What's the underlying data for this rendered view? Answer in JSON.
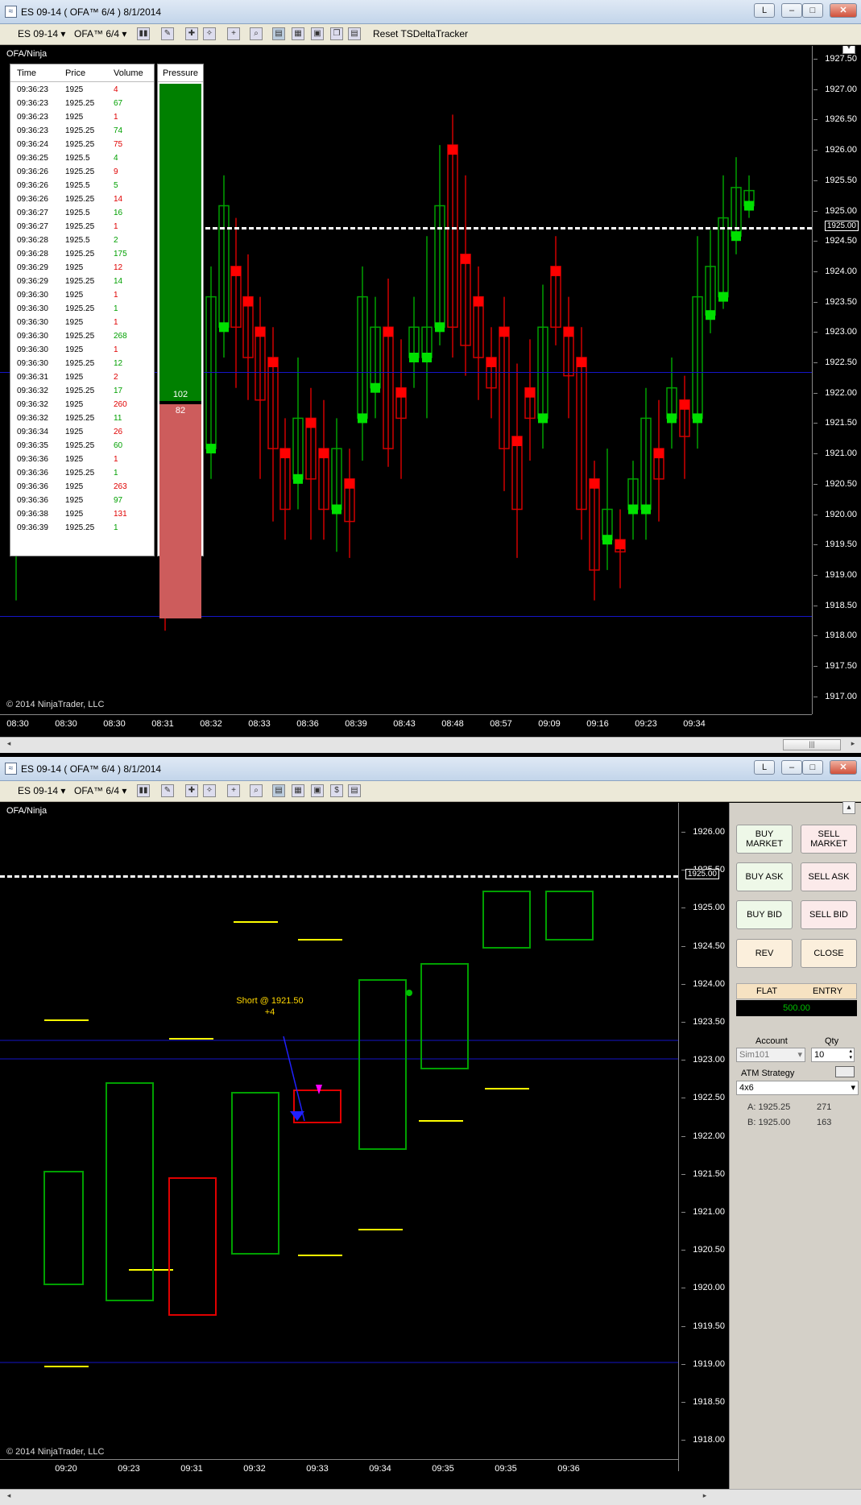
{
  "window_top": {
    "title": "ES 09-14 ( OFA™ 6/4 )  8/1/2014",
    "toolbar": {
      "instrument": "ES 09-14",
      "period": "OFA™ 6/4",
      "reset_label": "Reset TSDeltaTracker"
    },
    "chart_label": "OFA/Ninja",
    "copyright": "© 2014 NinjaTrader, LLC",
    "last_price": "1925.00",
    "y_ticks": [
      "1927.50",
      "1927.00",
      "1926.50",
      "1926.00",
      "1925.50",
      "1925.00",
      "1924.50",
      "1924.00",
      "1923.50",
      "1923.00",
      "1922.50",
      "1922.00",
      "1921.50",
      "1921.00",
      "1920.50",
      "1920.00",
      "1919.50",
      "1919.00",
      "1918.50",
      "1918.00",
      "1917.50",
      "1917.00"
    ],
    "x_ticks": [
      "08:30",
      "08:30",
      "08:30",
      "08:31",
      "08:32",
      "08:33",
      "08:36",
      "08:39",
      "08:43",
      "08:48",
      "08:57",
      "09:09",
      "09:16",
      "09:23",
      "09:34"
    ],
    "time_and_sales": {
      "headers": [
        "Time",
        "Price",
        "Volume"
      ],
      "rows": [
        [
          "09:36:23",
          "1925",
          "4",
          "sell"
        ],
        [
          "09:36:23",
          "1925.25",
          "67",
          "buy"
        ],
        [
          "09:36:23",
          "1925",
          "1",
          "sell"
        ],
        [
          "09:36:23",
          "1925.25",
          "74",
          "buy"
        ],
        [
          "09:36:24",
          "1925.25",
          "75",
          "sell"
        ],
        [
          "09:36:25",
          "1925.5",
          "4",
          "buy"
        ],
        [
          "09:36:26",
          "1925.25",
          "9",
          "sell"
        ],
        [
          "09:36:26",
          "1925.5",
          "5",
          "buy"
        ],
        [
          "09:36:26",
          "1925.25",
          "14",
          "sell"
        ],
        [
          "09:36:27",
          "1925.5",
          "16",
          "buy"
        ],
        [
          "09:36:27",
          "1925.25",
          "1",
          "sell"
        ],
        [
          "09:36:28",
          "1925.5",
          "2",
          "buy"
        ],
        [
          "09:36:28",
          "1925.25",
          "175",
          "buy"
        ],
        [
          "09:36:29",
          "1925",
          "12",
          "sell"
        ],
        [
          "09:36:29",
          "1925.25",
          "14",
          "buy"
        ],
        [
          "09:36:30",
          "1925",
          "1",
          "sell"
        ],
        [
          "09:36:30",
          "1925.25",
          "1",
          "buy"
        ],
        [
          "09:36:30",
          "1925",
          "1",
          "sell"
        ],
        [
          "09:36:30",
          "1925.25",
          "268",
          "buy"
        ],
        [
          "09:36:30",
          "1925",
          "1",
          "sell"
        ],
        [
          "09:36:30",
          "1925.25",
          "12",
          "buy"
        ],
        [
          "09:36:31",
          "1925",
          "2",
          "sell"
        ],
        [
          "09:36:32",
          "1925.25",
          "17",
          "buy"
        ],
        [
          "09:36:32",
          "1925",
          "260",
          "sell"
        ],
        [
          "09:36:32",
          "1925.25",
          "11",
          "buy"
        ],
        [
          "09:36:34",
          "1925",
          "26",
          "sell"
        ],
        [
          "09:36:35",
          "1925.25",
          "60",
          "buy"
        ],
        [
          "09:36:36",
          "1925",
          "1",
          "sell"
        ],
        [
          "09:36:36",
          "1925.25",
          "1",
          "buy"
        ],
        [
          "09:36:36",
          "1925",
          "263",
          "sell"
        ],
        [
          "09:36:36",
          "1925",
          "97",
          "buy"
        ],
        [
          "09:36:38",
          "1925",
          "131",
          "sell"
        ],
        [
          "09:36:39",
          "1925.25",
          "1",
          "buy"
        ]
      ]
    },
    "pressure": {
      "header": "Pressure",
      "buy_value": "102",
      "sell_value": "82"
    }
  },
  "window_bottom": {
    "title": "ES 09-14 ( OFA™ 6/4 )  8/1/2014",
    "toolbar": {
      "instrument": "ES 09-14",
      "period": "OFA™ 6/4"
    },
    "chart_label": "OFA/Ninja",
    "copyright": "© 2014 NinjaTrader, LLC",
    "last_price": "1925.00",
    "y_ticks": [
      "1926.00",
      "1925.50",
      "1925.00",
      "1924.50",
      "1924.00",
      "1923.50",
      "1923.00",
      "1922.50",
      "1922.00",
      "1921.50",
      "1921.00",
      "1920.50",
      "1920.00",
      "1919.50",
      "1919.00",
      "1918.50",
      "1918.00"
    ],
    "x_ticks": [
      "09:20",
      "09:23",
      "09:31",
      "09:32",
      "09:33",
      "09:34",
      "09:35",
      "09:35",
      "09:36"
    ],
    "annotations": {
      "short": "Short @ 1921.50",
      "short_qty": "+4"
    }
  },
  "chart_trader": {
    "buy_market": "BUY MARKET",
    "sell_market": "SELL MARKET",
    "buy_ask": "BUY ASK",
    "sell_ask": "SELL ASK",
    "buy_bid": "BUY BID",
    "sell_bid": "SELL BID",
    "rev": "REV",
    "close": "CLOSE",
    "flat": "FLAT",
    "entry": "ENTRY",
    "pnl": "500.00",
    "account_label": "Account",
    "account_value": "Sim101",
    "qty_label": "Qty",
    "qty_value": "10",
    "atm_label": "ATM Strategy",
    "atm_value": "4x6",
    "ask_label": "A: 1925.25",
    "ask_size": "271",
    "bid_label": "B: 1925.00",
    "bid_size": "163"
  },
  "colors": {
    "buy": "#00a000",
    "sell": "#e00000",
    "bg": "#000000",
    "panel": "#d4d0c8"
  }
}
